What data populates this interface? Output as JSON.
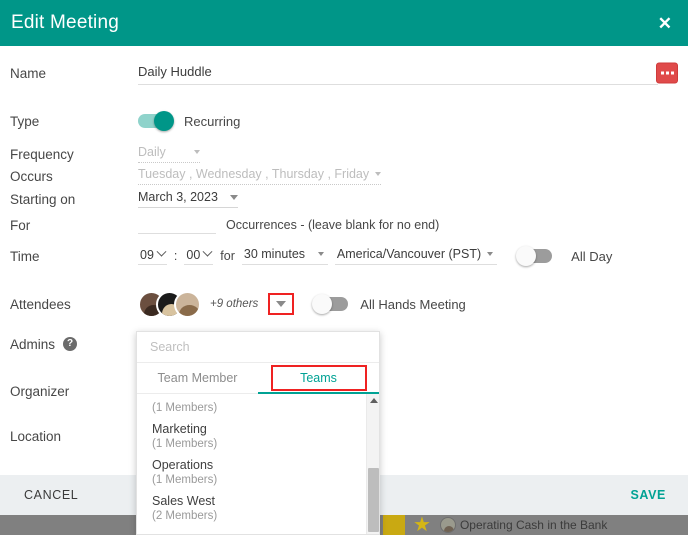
{
  "background": {
    "item_label": "Operating Cash in the Bank",
    "star_icon": "star-icon",
    "avatar_icon": "avatar-icon"
  },
  "header": {
    "title": "Edit Meeting",
    "close_icon": "✕",
    "color": "#009688"
  },
  "form": {
    "name": {
      "label": "Name",
      "value": "Daily Huddle",
      "placeholder": "",
      "action_icon": "more-options-icon",
      "action_color": "#e04a4a"
    },
    "type": {
      "label": "Type",
      "toggle_state": "on",
      "toggle_label": "Recurring"
    },
    "frequency": {
      "label": "Frequency",
      "value": "Daily",
      "disabled": "true"
    },
    "occurs": {
      "label": "Occurs",
      "value": "Tuesday , Wednesday , Thursday , Friday",
      "disabled": "true"
    },
    "starting_on": {
      "label": "Starting on",
      "value": "March 3, 2023"
    },
    "for": {
      "label": "For",
      "value": "",
      "hint": "Occurrences - (leave blank for no end)"
    },
    "time": {
      "label": "Time",
      "hour": "09",
      "separator": ":",
      "minute": "00",
      "for_text": "for",
      "duration": "30 minutes",
      "timezone": "America/Vancouver (PST)",
      "all_day_toggle_state": "off",
      "all_day_label": "All Day"
    },
    "attendees": {
      "label": "Attendees",
      "others_text": "+9 others",
      "avatars": [
        "attendee-avatar-1",
        "attendee-avatar-2",
        "attendee-avatar-3"
      ],
      "all_hands_toggle_state": "off",
      "all_hands_label": "All Hands Meeting"
    },
    "admins": {
      "label": "Admins",
      "help_icon": "?"
    },
    "organizer": {
      "label": "Organizer"
    },
    "location": {
      "label": "Location"
    }
  },
  "attendee_dropdown": {
    "search_placeholder": "Search",
    "tabs": [
      {
        "label": "Team Member",
        "active": "false"
      },
      {
        "label": "Teams",
        "active": "true"
      }
    ],
    "items": [
      {
        "name": "",
        "members": "(1 Members)"
      },
      {
        "name": "Marketing",
        "members": "(1 Members)"
      },
      {
        "name": "Operations",
        "members": "(1 Members)"
      },
      {
        "name": "Sales West",
        "members": "(2 Members)"
      }
    ],
    "scroll_up_icon": "caret-up-icon"
  },
  "footer": {
    "cancel_label": "CANCEL",
    "save_label": "SAVE",
    "save_color": "#00a294"
  }
}
